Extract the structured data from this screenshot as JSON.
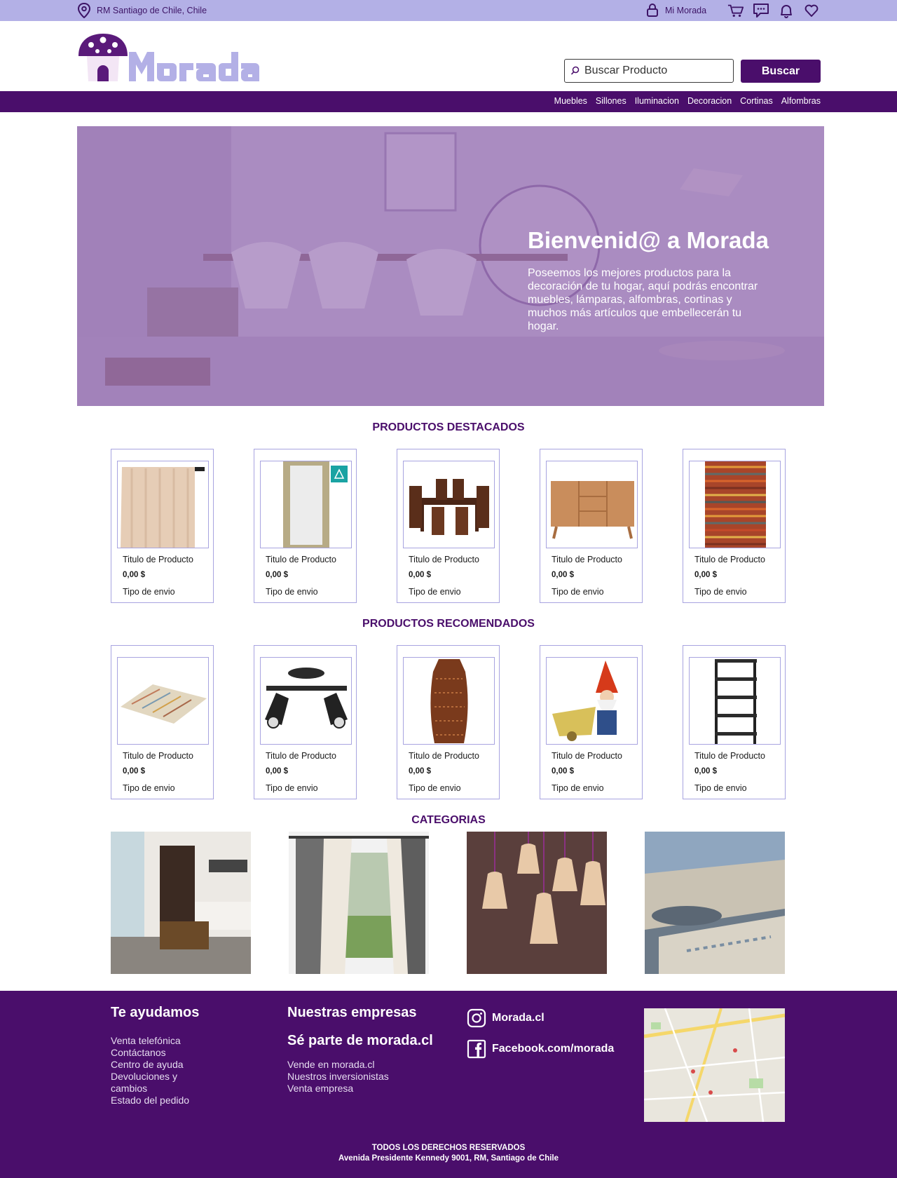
{
  "topbar": {
    "location": "RM Santiago de Chile, Chile",
    "account": "Mi Morada",
    "icons": [
      "cart-icon",
      "chat-icon",
      "bell-icon",
      "heart-icon"
    ]
  },
  "header": {
    "logo_text": "Morada",
    "search_placeholder": "Buscar Producto",
    "search_button": "Buscar"
  },
  "nav": {
    "items": [
      "Muebles",
      "Sillones",
      "Iluminacion",
      "Decoracion",
      "Cortinas",
      "Alfombras"
    ]
  },
  "hero": {
    "title": "Bienvenid@ a Morada",
    "text": "Poseemos los mejores productos para la decoración de tu hogar, aquí podrás encontrar muebles, lámparas, alfombras, cortinas y muchos más artículos que embellecerán tu hogar."
  },
  "featured": {
    "title": "PRODUCTOS DESTACADOS",
    "products": [
      {
        "title": "Titulo de Producto",
        "price": "0,00 $",
        "shipping": "Tipo de envio",
        "image": "curtain"
      },
      {
        "title": "Titulo de Producto",
        "price": "0,00 $",
        "shipping": "Tipo de envio",
        "image": "mirror"
      },
      {
        "title": "Titulo de Producto",
        "price": "0,00 $",
        "shipping": "Tipo de envio",
        "image": "dining-set"
      },
      {
        "title": "Titulo de Producto",
        "price": "0,00 $",
        "shipping": "Tipo de envio",
        "image": "sideboard"
      },
      {
        "title": "Titulo de Producto",
        "price": "0,00 $",
        "shipping": "Tipo de envio",
        "image": "striped-rug"
      }
    ]
  },
  "recommended": {
    "title": "PRODUCTOS RECOMENDADOS",
    "products": [
      {
        "title": "Titulo de Producto",
        "price": "0,00 $",
        "shipping": "Tipo de envio",
        "image": "rug"
      },
      {
        "title": "Titulo de Producto",
        "price": "0,00 $",
        "shipping": "Tipo de envio",
        "image": "spotlight"
      },
      {
        "title": "Titulo de Producto",
        "price": "0,00 $",
        "shipping": "Tipo de envio",
        "image": "vase"
      },
      {
        "title": "Titulo de Producto",
        "price": "0,00 $",
        "shipping": "Tipo de envio",
        "image": "gnome"
      },
      {
        "title": "Titulo de Producto",
        "price": "0,00 $",
        "shipping": "Tipo de envio",
        "image": "shelf"
      }
    ]
  },
  "categories": {
    "title": "CATEGORIAS",
    "images": [
      "living-room",
      "curtains",
      "lamps",
      "rugs"
    ]
  },
  "footer": {
    "help_title": "Te ayudamos",
    "help_links": [
      "Venta telefónica",
      "Contáctanos",
      "Centro de ayuda",
      "Devoluciones y",
      "cambios",
      "Estado del pedido"
    ],
    "companies_title": "Nuestras empresas",
    "join_title": "Sé parte de morada.cl",
    "join_links": [
      "Vende en morada.cl",
      "Nuestros inversionistas",
      "Venta empresa"
    ],
    "instagram": "Morada.cl",
    "facebook": "Facebook.com/morada",
    "rights": "TODOS LOS DERECHOS RESERVADOS",
    "address": "Avenida Presidente Kennedy 9001, RM, Santiago de Chile"
  },
  "colors": {
    "primary": "#4a0e6b",
    "topbar": "#b3b0e6",
    "card_border": "#a8a4e0"
  }
}
